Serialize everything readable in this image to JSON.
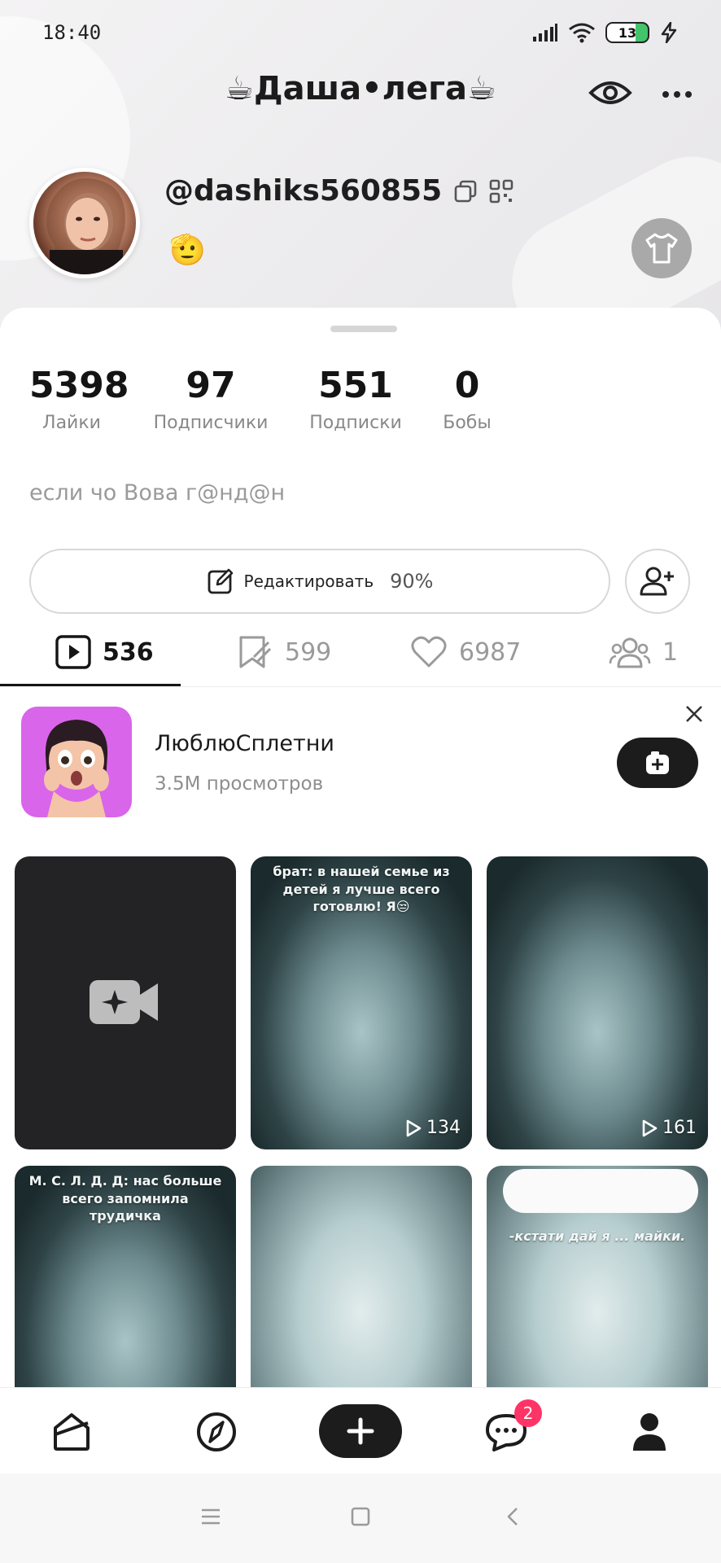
{
  "status_bar": {
    "time": "18:40",
    "battery": "13"
  },
  "profile": {
    "title": "☕Даша•лега☕",
    "handle": "@dashiks560855",
    "emoji": "🫡",
    "bio": "если чо Вова г@нд@н"
  },
  "stats": [
    {
      "value": "5398",
      "label": "Лайки"
    },
    {
      "value": "97",
      "label": "Подписчики"
    },
    {
      "value": "551",
      "label": "Подписки"
    },
    {
      "value": "0",
      "label": "Бобы"
    }
  ],
  "edit": {
    "label": "Редактировать",
    "percent": "90%"
  },
  "tabs": [
    {
      "icon": "play-square-icon",
      "count": "536"
    },
    {
      "icon": "bookmark-tag-icon",
      "count": "599"
    },
    {
      "icon": "heart-icon",
      "count": "6987"
    },
    {
      "icon": "people-icon",
      "count": "1"
    }
  ],
  "promo": {
    "title": "ЛюблюСплетни",
    "subtitle": "3.5M просмотров"
  },
  "videos": [
    {
      "type": "create",
      "icon": "video-camera-icon"
    },
    {
      "caption": "брат: в нашей семье из детей я лучше всего готовлю! Я😒",
      "views": "134"
    },
    {
      "caption": "",
      "views": "161"
    },
    {
      "caption": "М. С. Л. Д. Д: нас больше всего запомнила трудичка",
      "views": ""
    },
    {
      "caption": "",
      "views": ""
    },
    {
      "caption": "-кстати дай я ... майки.",
      "views": ""
    }
  ],
  "nav": {
    "messages_badge": "2"
  },
  "colors": {
    "accent": "#1c1c1c",
    "badge": "#ff3466",
    "promo_bg": "#d965ea"
  }
}
